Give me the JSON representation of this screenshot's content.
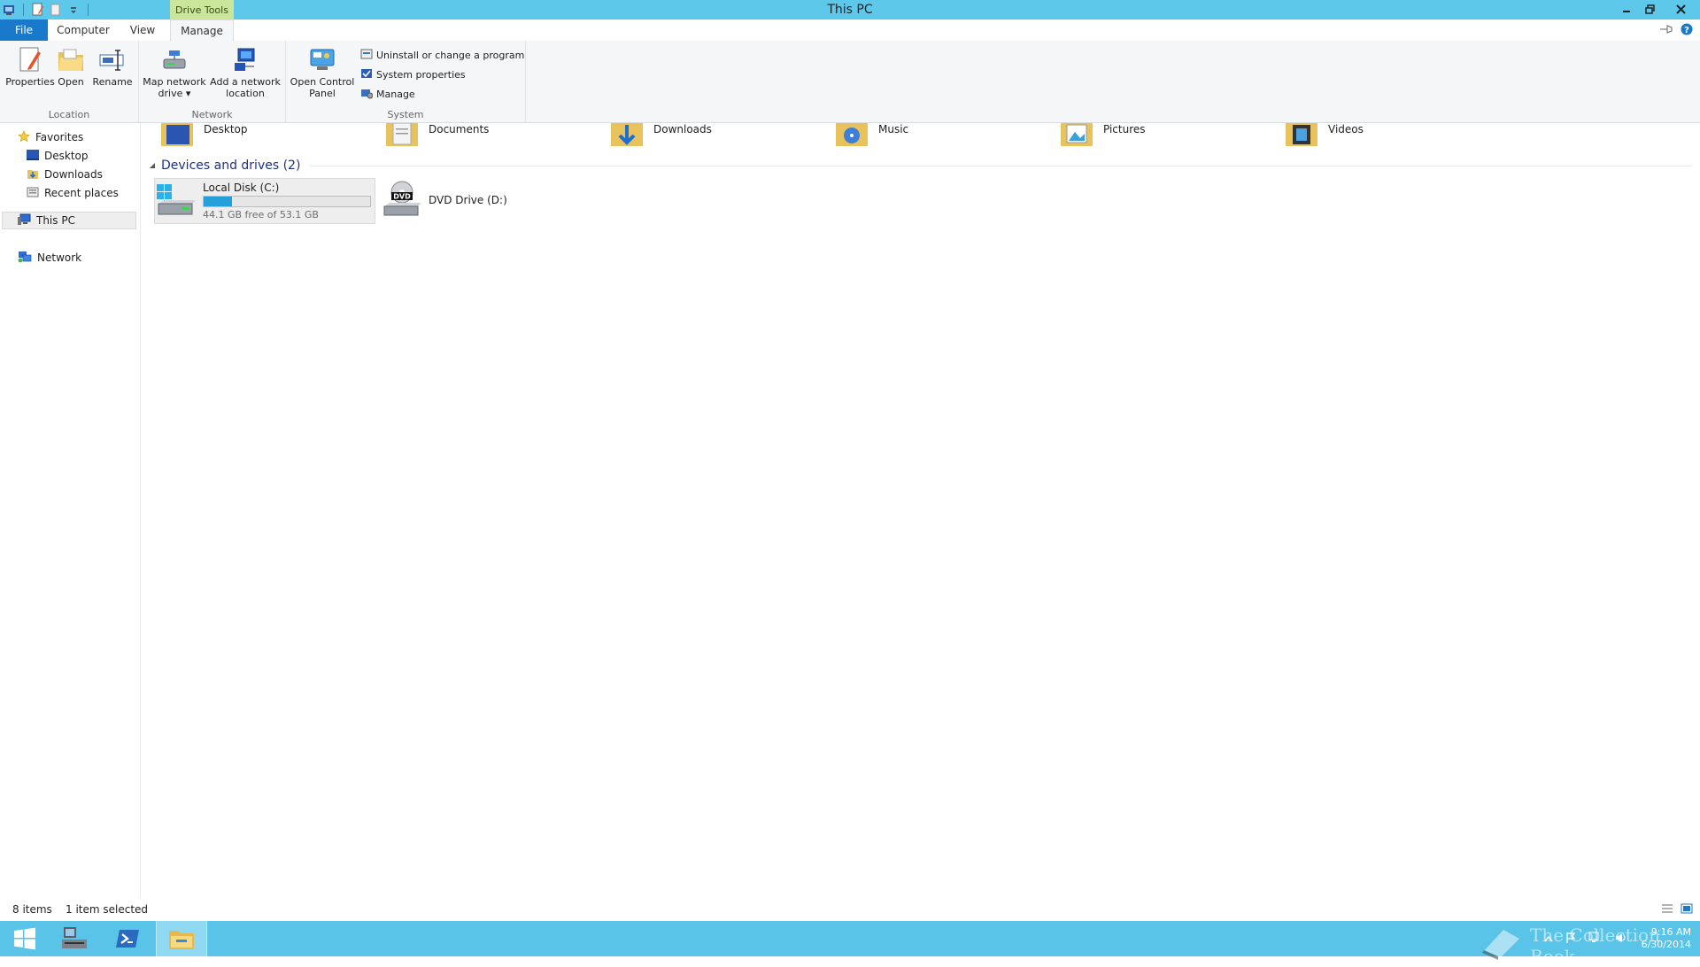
{
  "window": {
    "title": "This PC",
    "context_tab": "Drive Tools"
  },
  "tabs": [
    {
      "label": "File"
    },
    {
      "label": "Computer"
    },
    {
      "label": "View"
    },
    {
      "label": "Manage"
    }
  ],
  "ribbon": {
    "location": {
      "label": "Location",
      "properties": "Properties",
      "open": "Open",
      "rename": "Rename"
    },
    "network": {
      "label": "Network",
      "map_drive_1": "Map network",
      "map_drive_2": "drive",
      "add_location_1": "Add a network",
      "add_location_2": "location"
    },
    "system": {
      "label": "System",
      "open_cp_1": "Open Control",
      "open_cp_2": "Panel",
      "uninstall": "Uninstall or change a program",
      "system_properties": "System properties",
      "manage": "Manage"
    }
  },
  "nav": {
    "favorites": "Favorites",
    "desktop": "Desktop",
    "downloads": "Downloads",
    "recent": "Recent places",
    "thispc": "This PC",
    "network": "Network"
  },
  "folders": [
    {
      "name": "Desktop"
    },
    {
      "name": "Documents"
    },
    {
      "name": "Downloads"
    },
    {
      "name": "Music"
    },
    {
      "name": "Pictures"
    },
    {
      "name": "Videos"
    }
  ],
  "devices": {
    "header": "Devices and drives (2)",
    "drives": [
      {
        "name": "Local Disk (C:)",
        "free": "44.1 GB free of 53.1 GB",
        "used_fraction": 0.17
      },
      {
        "name": "DVD Drive (D:)"
      }
    ]
  },
  "status": {
    "items": "8 items",
    "selected": "1 item selected"
  },
  "taskbar": {
    "time": "9:16 AM",
    "date": "6/30/2014",
    "watermark": "The Collection Book"
  },
  "colors": {
    "titlebar": "#5ec8ea",
    "file_tab": "#1979ca",
    "drive_tools": "#c9e69b",
    "taskbar": "#59c4e7",
    "progress": "#26a0da"
  }
}
